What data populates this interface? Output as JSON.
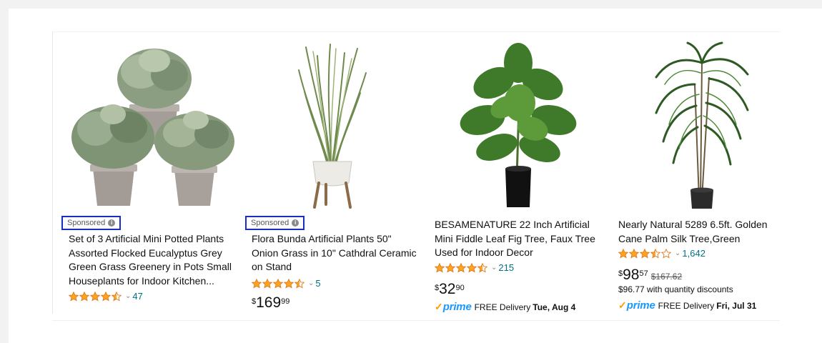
{
  "colors": {
    "title_text": "#0f1111",
    "link_text": "#007185",
    "star_fill": "#ffa41c",
    "star_stroke": "#de7921",
    "sponsored_border": "#1a2fbf",
    "prime_blue": "#1a98ff",
    "prime_check": "#ff9900"
  },
  "products": [
    {
      "image_icon": "potted-eucalyptus-plants-image",
      "sponsored_label": "Sponsored",
      "title_lines": [
        "Set of 3 Artificial Mini Potted Plants",
        "Assorted Flocked Eucalyptus Grey",
        "Green Grass Greenery in Pots Small",
        "Houseplants for Indoor Kitchen..."
      ],
      "rating": 4.5,
      "review_count": "47"
    },
    {
      "image_icon": "onion-grass-plant-image",
      "sponsored_label": "Sponsored",
      "title_lines": [
        "Flora Bunda Artificial Plants 50\"",
        "Onion Grass in 10\" Cathdral Ceramic",
        "on Stand"
      ],
      "rating": 4.5,
      "review_count": "5",
      "price": {
        "symbol": "$",
        "whole": "169",
        "fraction": "99"
      }
    },
    {
      "image_icon": "fiddle-leaf-fig-tree-image",
      "title_lines": [
        "BESAMENATURE 22 Inch Artificial",
        "Mini Fiddle Leaf Fig Tree, Faux Tree",
        "Used for Indoor Decor"
      ],
      "rating": 4.5,
      "review_count": "215",
      "price": {
        "symbol": "$",
        "whole": "32",
        "fraction": "90"
      },
      "delivery": {
        "prime_check": "✓",
        "prime_label": "prime",
        "text": "FREE Delivery",
        "date": "Tue, Aug 4"
      }
    },
    {
      "image_icon": "palm-silk-tree-image",
      "title_lines": [
        "Nearly Natural 5289 6.5ft. Golden",
        "Cane Palm Silk Tree,Green"
      ],
      "rating": 3.5,
      "review_count": "1,642",
      "price": {
        "symbol": "$",
        "whole": "98",
        "fraction": "57",
        "list_price": "$167.62"
      },
      "discount_text": "$96.77 with quantity discounts",
      "delivery": {
        "prime_check": "✓",
        "prime_label": "prime",
        "text": "FREE Delivery",
        "date": "Fri, Jul 31"
      }
    }
  ]
}
